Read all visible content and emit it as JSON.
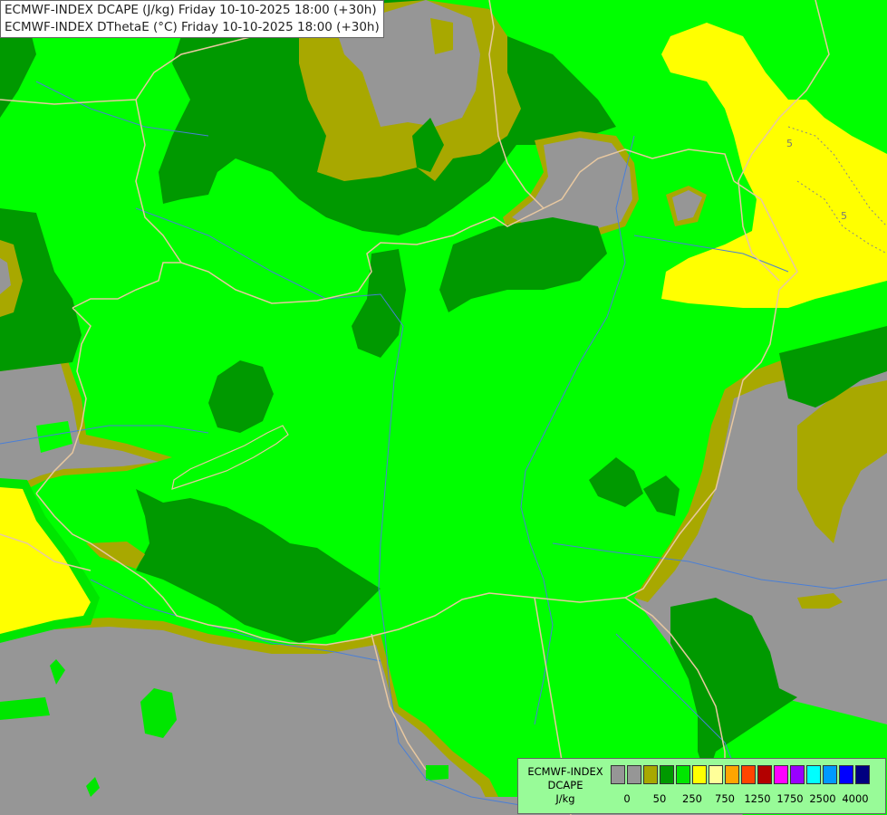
{
  "header": {
    "line1": "ECMWF-INDEX DCAPE (J/kg) Friday 10-10-2025 18:00 (+30h)",
    "line2": "ECMWF-INDEX DThetaE (°C) Friday 10-10-2025 18:00 (+30h)"
  },
  "legend": {
    "title_line1": "ECMWF-INDEX",
    "title_line2": "DCAPE",
    "title_line3": "J/kg",
    "swatch_colors": [
      "#969696",
      "#969696",
      "#a8a800",
      "#009900",
      "#00e600",
      "#ffff00",
      "#ffff99",
      "#ffa500",
      "#ff4500",
      "#b30000",
      "#ff00ff",
      "#9900ff",
      "#00ffff",
      "#0099ff",
      "#0000ff",
      "#000080"
    ],
    "tick_labels": [
      "0",
      "50",
      "250",
      "750",
      "1250",
      "1750",
      "2500",
      "4000"
    ]
  },
  "map_colors": {
    "gray": "#969696",
    "olive": "#a8a800",
    "dark_green": "#009900",
    "light_green": "#00ff00",
    "yellow": "#ffff00",
    "border": "#e8c8a0",
    "river": "#4a7fd6"
  },
  "contour_labels": [
    "5",
    "5"
  ]
}
